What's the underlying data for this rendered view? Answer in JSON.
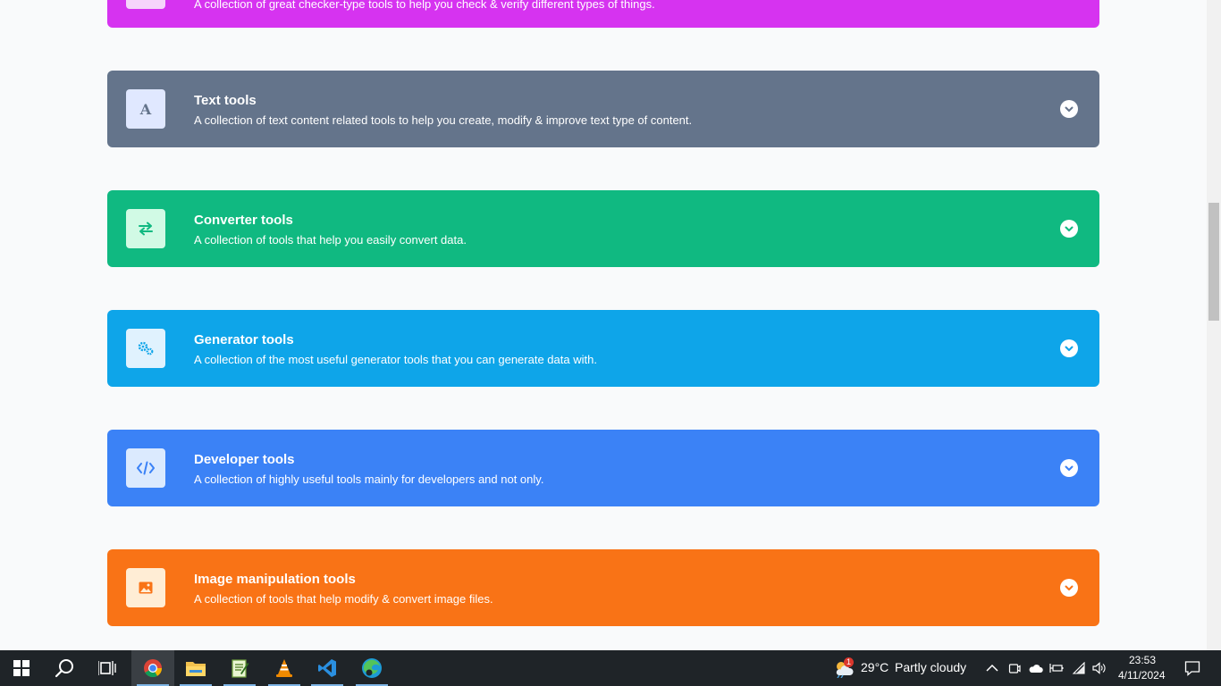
{
  "cards": [
    {
      "id": "checker",
      "title": "",
      "description": "A collection of great checker-type tools to help you check & verify different types of things.",
      "color": "#d633f0",
      "icon_box_color": "#f6d4fb"
    },
    {
      "id": "text",
      "title": "Text tools",
      "description": "A collection of text content related tools to help you create, modify & improve text type of content.",
      "color": "#64748b",
      "icon_box_color": "#e0e8ff",
      "icon_glyph": "A",
      "icon": "text-letter-icon"
    },
    {
      "id": "converter",
      "title": "Converter tools",
      "description": "A collection of tools that help you easily convert data.",
      "color": "#10b981",
      "icon_box_color": "#d1fae5",
      "icon": "arrows-exchange-icon"
    },
    {
      "id": "generator",
      "title": "Generator tools",
      "description": "A collection of the most useful generator tools that you can generate data with.",
      "color": "#0ea5e9",
      "icon_box_color": "#e0f2fe",
      "icon": "gears-icon"
    },
    {
      "id": "developer",
      "title": "Developer tools",
      "description": "A collection of highly useful tools mainly for developers and not only.",
      "color": "#3b82f6",
      "icon_box_color": "#dbeafe",
      "icon": "code-icon"
    },
    {
      "id": "image",
      "title": "Image manipulation tools",
      "description": "A collection of tools that help modify & convert image files.",
      "color": "#f97316",
      "icon_box_color": "#ffedd5",
      "icon": "image-icon"
    }
  ],
  "taskbar": {
    "apps": [
      "start-icon",
      "search-icon",
      "task-view-icon",
      "chrome-icon",
      "file-explorer-icon",
      "notepad-icon",
      "vlc-icon",
      "vscode-icon",
      "edge-icon"
    ],
    "weather": {
      "temp": "29°C",
      "condition": "Partly cloudy",
      "badge": "1"
    },
    "clock": {
      "time": "23:53",
      "date": "4/11/2024"
    }
  }
}
